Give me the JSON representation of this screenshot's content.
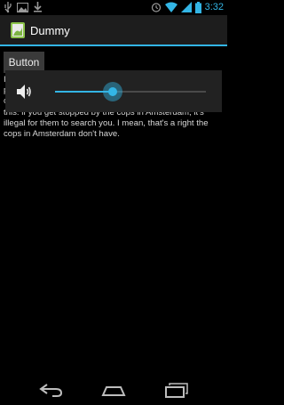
{
  "status_bar": {
    "time": "3:32",
    "left_icons": [
      "usb-icon",
      "image-icon",
      "download-icon"
    ],
    "right_icons": [
      "alarm-icon",
      "wifi-icon",
      "signal-icon",
      "battery-icon"
    ],
    "accent": "#33b5e5"
  },
  "action_bar": {
    "title": "Dummy",
    "icon": "app-icon"
  },
  "main": {
    "button_label": "Button",
    "body_text": "It's legal to buy it, it's legal to own it and, if you're the proprietor of a hash bar, it's legal to sell it. It's legal to carry it, which doesn't really matter 'cause... get a load of this: if you get stopped by the cops in Amsterdam, it's illegal for them to search you. I mean, that's a right the cops in Amsterdam don't have."
  },
  "volume_panel": {
    "icon": "speaker-icon",
    "level": 0.38
  },
  "nav_bar": {
    "buttons": [
      "back-icon",
      "home-icon",
      "recent-apps-icon"
    ]
  }
}
